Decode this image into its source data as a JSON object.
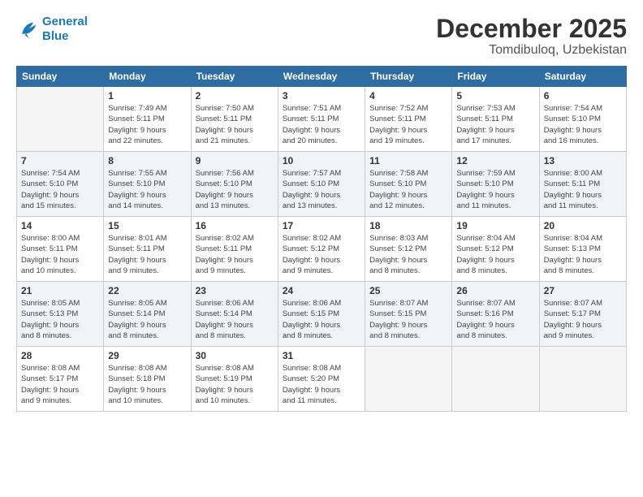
{
  "logo": {
    "line1": "General",
    "line2": "Blue"
  },
  "title": "December 2025",
  "location": "Tomdibuloq, Uzbekistan",
  "weekdays": [
    "Sunday",
    "Monday",
    "Tuesday",
    "Wednesday",
    "Thursday",
    "Friday",
    "Saturday"
  ],
  "weeks": [
    [
      {
        "day": "",
        "info": ""
      },
      {
        "day": "1",
        "info": "Sunrise: 7:49 AM\nSunset: 5:11 PM\nDaylight: 9 hours\nand 22 minutes."
      },
      {
        "day": "2",
        "info": "Sunrise: 7:50 AM\nSunset: 5:11 PM\nDaylight: 9 hours\nand 21 minutes."
      },
      {
        "day": "3",
        "info": "Sunrise: 7:51 AM\nSunset: 5:11 PM\nDaylight: 9 hours\nand 20 minutes."
      },
      {
        "day": "4",
        "info": "Sunrise: 7:52 AM\nSunset: 5:11 PM\nDaylight: 9 hours\nand 19 minutes."
      },
      {
        "day": "5",
        "info": "Sunrise: 7:53 AM\nSunset: 5:11 PM\nDaylight: 9 hours\nand 17 minutes."
      },
      {
        "day": "6",
        "info": "Sunrise: 7:54 AM\nSunset: 5:10 PM\nDaylight: 9 hours\nand 16 minutes."
      }
    ],
    [
      {
        "day": "7",
        "info": "Sunrise: 7:54 AM\nSunset: 5:10 PM\nDaylight: 9 hours\nand 15 minutes."
      },
      {
        "day": "8",
        "info": "Sunrise: 7:55 AM\nSunset: 5:10 PM\nDaylight: 9 hours\nand 14 minutes."
      },
      {
        "day": "9",
        "info": "Sunrise: 7:56 AM\nSunset: 5:10 PM\nDaylight: 9 hours\nand 13 minutes."
      },
      {
        "day": "10",
        "info": "Sunrise: 7:57 AM\nSunset: 5:10 PM\nDaylight: 9 hours\nand 13 minutes."
      },
      {
        "day": "11",
        "info": "Sunrise: 7:58 AM\nSunset: 5:10 PM\nDaylight: 9 hours\nand 12 minutes."
      },
      {
        "day": "12",
        "info": "Sunrise: 7:59 AM\nSunset: 5:10 PM\nDaylight: 9 hours\nand 11 minutes."
      },
      {
        "day": "13",
        "info": "Sunrise: 8:00 AM\nSunset: 5:11 PM\nDaylight: 9 hours\nand 11 minutes."
      }
    ],
    [
      {
        "day": "14",
        "info": "Sunrise: 8:00 AM\nSunset: 5:11 PM\nDaylight: 9 hours\nand 10 minutes."
      },
      {
        "day": "15",
        "info": "Sunrise: 8:01 AM\nSunset: 5:11 PM\nDaylight: 9 hours\nand 9 minutes."
      },
      {
        "day": "16",
        "info": "Sunrise: 8:02 AM\nSunset: 5:11 PM\nDaylight: 9 hours\nand 9 minutes."
      },
      {
        "day": "17",
        "info": "Sunrise: 8:02 AM\nSunset: 5:12 PM\nDaylight: 9 hours\nand 9 minutes."
      },
      {
        "day": "18",
        "info": "Sunrise: 8:03 AM\nSunset: 5:12 PM\nDaylight: 9 hours\nand 8 minutes."
      },
      {
        "day": "19",
        "info": "Sunrise: 8:04 AM\nSunset: 5:12 PM\nDaylight: 9 hours\nand 8 minutes."
      },
      {
        "day": "20",
        "info": "Sunrise: 8:04 AM\nSunset: 5:13 PM\nDaylight: 9 hours\nand 8 minutes."
      }
    ],
    [
      {
        "day": "21",
        "info": "Sunrise: 8:05 AM\nSunset: 5:13 PM\nDaylight: 9 hours\nand 8 minutes."
      },
      {
        "day": "22",
        "info": "Sunrise: 8:05 AM\nSunset: 5:14 PM\nDaylight: 9 hours\nand 8 minutes."
      },
      {
        "day": "23",
        "info": "Sunrise: 8:06 AM\nSunset: 5:14 PM\nDaylight: 9 hours\nand 8 minutes."
      },
      {
        "day": "24",
        "info": "Sunrise: 8:06 AM\nSunset: 5:15 PM\nDaylight: 9 hours\nand 8 minutes."
      },
      {
        "day": "25",
        "info": "Sunrise: 8:07 AM\nSunset: 5:15 PM\nDaylight: 9 hours\nand 8 minutes."
      },
      {
        "day": "26",
        "info": "Sunrise: 8:07 AM\nSunset: 5:16 PM\nDaylight: 9 hours\nand 8 minutes."
      },
      {
        "day": "27",
        "info": "Sunrise: 8:07 AM\nSunset: 5:17 PM\nDaylight: 9 hours\nand 9 minutes."
      }
    ],
    [
      {
        "day": "28",
        "info": "Sunrise: 8:08 AM\nSunset: 5:17 PM\nDaylight: 9 hours\nand 9 minutes."
      },
      {
        "day": "29",
        "info": "Sunrise: 8:08 AM\nSunset: 5:18 PM\nDaylight: 9 hours\nand 10 minutes."
      },
      {
        "day": "30",
        "info": "Sunrise: 8:08 AM\nSunset: 5:19 PM\nDaylight: 9 hours\nand 10 minutes."
      },
      {
        "day": "31",
        "info": "Sunrise: 8:08 AM\nSunset: 5:20 PM\nDaylight: 9 hours\nand 11 minutes."
      },
      {
        "day": "",
        "info": ""
      },
      {
        "day": "",
        "info": ""
      },
      {
        "day": "",
        "info": ""
      }
    ]
  ]
}
